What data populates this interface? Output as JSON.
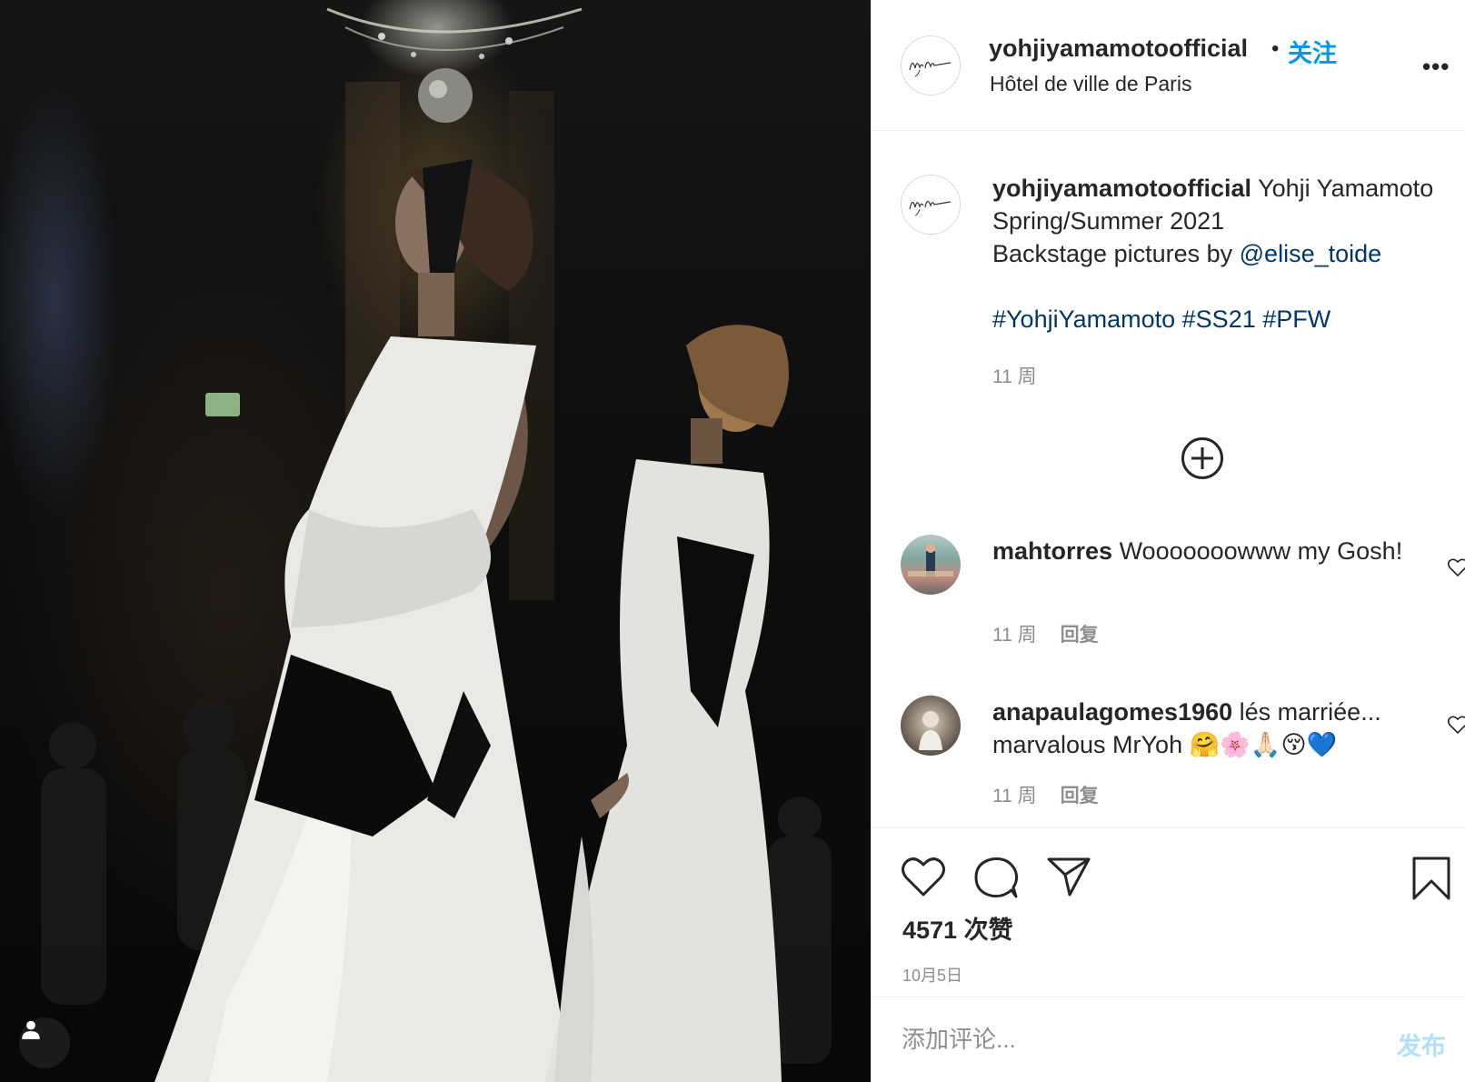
{
  "post": {
    "author": "yohjiyamamotoofficial",
    "location": "Hôtel de ville de Paris",
    "follow_label": "关注",
    "separator": "•",
    "more_label": "•••",
    "avatar_icon": "yohji-signature-logo"
  },
  "caption": {
    "author": "yohjiyamamotoofficial",
    "line1": "Yohji Yamamoto Spring/Summer 2021",
    "line2_prefix": "Backstage pictures by ",
    "mention": "@elise_toide",
    "hashtags": [
      "#YohjiYamamoto",
      "#SS21",
      "#PFW"
    ],
    "time": "11 周"
  },
  "load_more_icon": "plus-circle-icon",
  "comments": [
    {
      "user": "mahtorres",
      "text": "Wooooooowww my Gosh!",
      "time": "11 周",
      "reply_label": "回复"
    },
    {
      "user": "anapaulagomes1960",
      "text": "lés marriée... marvalous MrYoh 🤗🌸🙏🏻😚💙",
      "time": "11 周",
      "reply_label": "回复"
    }
  ],
  "actions": {
    "icons": [
      "heart-icon",
      "comment-icon",
      "share-icon",
      "bookmark-icon"
    ],
    "likes": "4571 次赞",
    "date": "10月5日"
  },
  "add_comment": {
    "placeholder": "添加评论...",
    "post_label": "发布"
  },
  "colors": {
    "link": "#00376b",
    "follow": "#0095f6",
    "post_disabled": "#b2dffc",
    "muted": "#8e8e8e",
    "border": "#efefef"
  }
}
